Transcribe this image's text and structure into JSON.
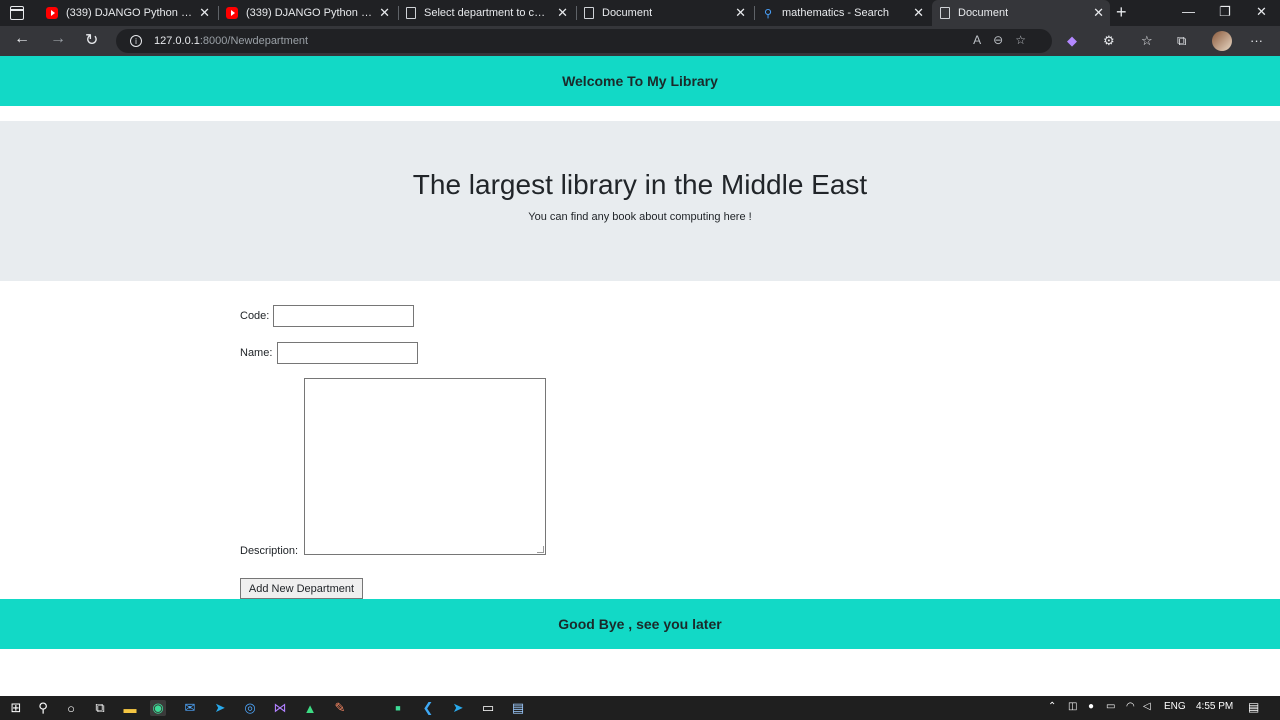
{
  "browser": {
    "tabs": [
      {
        "label": "(339) DJANGO Python Lesson",
        "favicon": "youtube-icon"
      },
      {
        "label": "(339) DJANGO Python Lesson",
        "favicon": "youtube-icon"
      },
      {
        "label": "Select department to change",
        "favicon": "document-icon"
      },
      {
        "label": "Document",
        "favicon": "document-icon"
      },
      {
        "label": "mathematics - Search",
        "favicon": "search-icon"
      },
      {
        "label": "Document",
        "favicon": "document-icon",
        "active": true
      }
    ],
    "url_host": "127.0.0.1",
    "url_path": ":8000/Newdepartment"
  },
  "page": {
    "navbar_title": "Welcome To My Library",
    "hero_title": "The largest library in the Middle East",
    "hero_subtitle": "You can find any book about computing here !",
    "form": {
      "code_label": "Code:",
      "code_value": "",
      "name_label": "Name:",
      "name_value": "",
      "description_label": "Description:",
      "description_value": "",
      "submit_label": "Add New Department"
    },
    "footer_text": "Good Bye , see you later"
  },
  "taskbar": {
    "language": "ENG",
    "time": "4:55 PM"
  },
  "colors": {
    "accent": "#12d9c6",
    "hero_bg": "#e8ecef",
    "browser_dark": "#202124"
  }
}
